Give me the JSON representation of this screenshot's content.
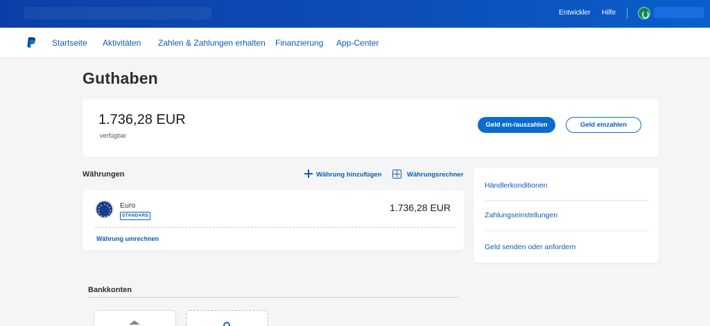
{
  "topbar": {
    "links": [
      "Entwickler",
      "Hilfe"
    ]
  },
  "nav": {
    "items": [
      "Startseite",
      "Aktivitäten",
      "Zahlen & Zahlungen erhalten",
      "Finanzierung",
      "App-Center"
    ]
  },
  "page": {
    "title": "Guthaben"
  },
  "balance": {
    "amount": "1.736,28 EUR",
    "subtitle": "verfügbar",
    "primary_button": "Geld ein-/auszahlen",
    "secondary_button": "Geld einzahlen"
  },
  "currencies": {
    "section_title": "Währungen",
    "add_label": "Währung hinzufügen",
    "calculator_label": "Währungsrechner",
    "items": [
      {
        "name": "Euro",
        "badge": "STANDARD",
        "amount": "1.736,28 EUR"
      }
    ],
    "convert_label": "Währung umrechnen"
  },
  "side_links": [
    "Händlerkonditionen",
    "Zahlungseinstellungen",
    "Geld senden oder anfordern"
  ],
  "bank": {
    "section_title": "Bankkonten"
  },
  "colors": {
    "brand": "#0a6ccd",
    "topbar": "#0b3fa8",
    "link": "#0a5bb5"
  }
}
